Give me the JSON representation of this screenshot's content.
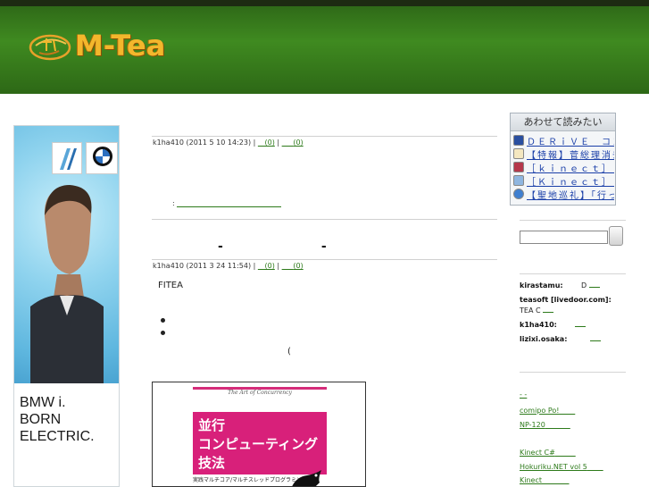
{
  "site": {
    "logo_text": "M-Tea",
    "logo_icon": "tea-cup-logo-icon"
  },
  "ad": {
    "lines": [
      "BMW i.",
      "BORN",
      "ELECTRIC."
    ],
    "brand_icon": "bmw-logo-icon"
  },
  "posts": [
    {
      "meta_author_date": "k1ha410 (2011 5 10  14:23) |",
      "comments_link": "(0)",
      "trackback_link": "(0)",
      "link_prefix": ":"
    },
    {
      "title_parts": [
        "-",
        "-"
      ],
      "meta_author_date": "k1ha410 (2011 3 24  11:54) |",
      "comments_link": "(0)",
      "trackback_link": "(0)",
      "body_text": "FITEA",
      "paren_text": "(",
      "book": {
        "subtitle": "The Art of Concurrency",
        "title_lines": [
          "並行",
          "コンピューティング",
          "技法"
        ],
        "footer": "実践マルチコア/マルチスレッドプログラミング"
      }
    }
  ],
  "awasete": {
    "title": "あわせて読みたい",
    "items": [
      {
        "label": "ＤＥＲｉＶＥ　コンピュ",
        "icon": "site-favicon-icon"
      },
      {
        "label": "【特報】菅総理消去に向",
        "icon": "news-favicon-icon"
      },
      {
        "label": "［ｋｉｎｅｃｔ］Ｋｉｎ",
        "icon": "blog-favicon-icon"
      },
      {
        "label": "［Ｋｉｎｅｃｔ］Ｋｉｎ",
        "icon": "blog-favicon-icon"
      },
      {
        "label": "【聖地巡礼】「行ってみ",
        "icon": "globe-favicon-icon"
      }
    ]
  },
  "search": {
    "input_value": "",
    "button_label": ""
  },
  "recent_comments": [
    {
      "author": "kirastamu:",
      "text": "D"
    },
    {
      "author": "teasoft [livedoor.com]:",
      "text": "TEA C"
    },
    {
      "author": "k1ha410:",
      "text": ""
    },
    {
      "author": "lizixi.osaka:",
      "text": ""
    }
  ],
  "links": [
    "-        -",
    "comipo    Po!",
    "NP-120",
    "",
    "Kinect C#",
    "Hokuriku.NET vol 5",
    "Kinect"
  ],
  "colors": {
    "header_green": "#3f8a20",
    "logo_orange": "#f3b72c",
    "link_green": "#2d7a1a",
    "awasete_link": "#1a3fa8",
    "book_magenta": "#d8207a"
  }
}
